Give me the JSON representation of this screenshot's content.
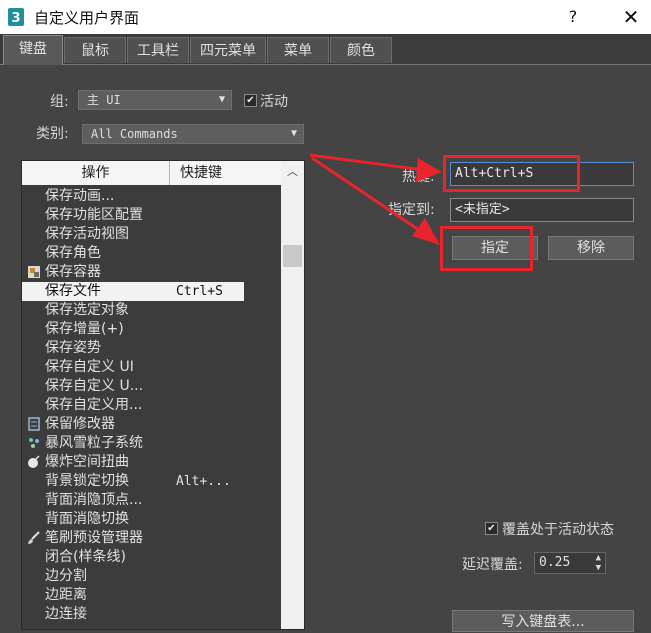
{
  "window": {
    "title": "自定义用户界面",
    "help_label": "?",
    "close_label": "✕"
  },
  "tabs": [
    {
      "label": "键盘",
      "active": true
    },
    {
      "label": "鼠标",
      "active": false
    },
    {
      "label": "工具栏",
      "active": false
    },
    {
      "label": "四元菜单",
      "active": false
    },
    {
      "label": "菜单",
      "active": false
    },
    {
      "label": "颜色",
      "active": false
    }
  ],
  "group": {
    "label": "组:",
    "value": "主 UI",
    "active_checked": true,
    "active_label": "活动"
  },
  "category": {
    "label": "类别:",
    "value": "All Commands"
  },
  "list": {
    "header_action": "操作",
    "header_shortcut": "快捷键",
    "rows": [
      {
        "label": "保存动画...",
        "shortcut": "",
        "icon": ""
      },
      {
        "label": "保存功能区配置",
        "shortcut": "",
        "icon": ""
      },
      {
        "label": "保存活动视图",
        "shortcut": "",
        "icon": ""
      },
      {
        "label": "保存角色",
        "shortcut": "",
        "icon": ""
      },
      {
        "label": "保存容器",
        "shortcut": "",
        "icon": "container-icon"
      },
      {
        "label": "保存文件",
        "shortcut": "Ctrl+S",
        "icon": "",
        "selected": true
      },
      {
        "label": "保存选定对象",
        "shortcut": "",
        "icon": ""
      },
      {
        "label": "保存增量(+)",
        "shortcut": "",
        "icon": ""
      },
      {
        "label": "保存姿势",
        "shortcut": "",
        "icon": ""
      },
      {
        "label": "保存自定义 UI",
        "shortcut": "",
        "icon": ""
      },
      {
        "label": "保存自定义 U...",
        "shortcut": "",
        "icon": ""
      },
      {
        "label": "保存自定义用...",
        "shortcut": "",
        "icon": ""
      },
      {
        "label": "保留修改器",
        "shortcut": "",
        "icon": "modifier-icon"
      },
      {
        "label": "暴风雪粒子系统",
        "shortcut": "",
        "icon": "particle-icon"
      },
      {
        "label": "爆炸空间扭曲",
        "shortcut": "",
        "icon": "bomb-icon"
      },
      {
        "label": "背景锁定切换",
        "shortcut": "Alt+...",
        "icon": ""
      },
      {
        "label": "背面消隐顶点...",
        "shortcut": "",
        "icon": ""
      },
      {
        "label": "背面消隐切换",
        "shortcut": "",
        "icon": ""
      },
      {
        "label": "笔刷预设管理器",
        "shortcut": "",
        "icon": "brush-icon"
      },
      {
        "label": "闭合(样条线)",
        "shortcut": "",
        "icon": ""
      },
      {
        "label": "边分割",
        "shortcut": "",
        "icon": ""
      },
      {
        "label": "边距离",
        "shortcut": "",
        "icon": ""
      },
      {
        "label": "边连接",
        "shortcut": "",
        "icon": ""
      }
    ]
  },
  "hotkey": {
    "label": "热键:",
    "value": "Alt+Ctrl+S"
  },
  "assigned_to": {
    "label": "指定到:",
    "value": "<未指定>"
  },
  "buttons": {
    "assign": "指定",
    "remove": "移除",
    "write_keyboard": "写入键盘表..."
  },
  "override": {
    "checked": true,
    "label": "覆盖处于活动状态",
    "delay_label": "延迟覆盖:",
    "delay_value": "0.25"
  },
  "colors": {
    "annotation_red": "#e8242c",
    "arrow_red": "#e8242c",
    "accent_blue": "#5a8fd6"
  }
}
